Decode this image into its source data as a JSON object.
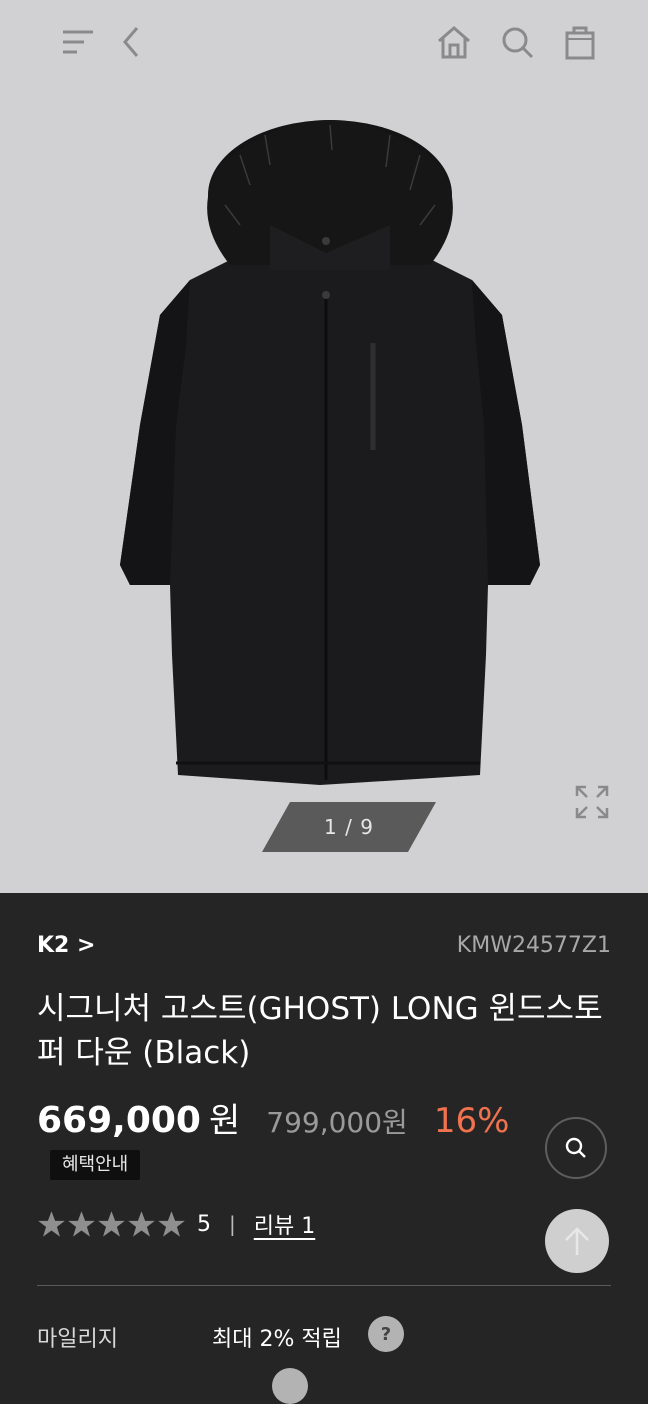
{
  "header": {
    "icons": [
      "menu-icon",
      "back-icon",
      "home-icon",
      "search-icon",
      "shopping-bag-icon"
    ]
  },
  "gallery": {
    "pager": "1 / 9",
    "current": 1,
    "total": 9,
    "image": "black-long-down-parka-with-fur-hood"
  },
  "product": {
    "brand": "K2 >",
    "code": "KMW24577Z1",
    "title": "시그니처 고스트(GHOST) LONG 윈드스토퍼 다운 (Black)",
    "price_sale": "669,000",
    "price_unit": "원",
    "price_original": "799,000원",
    "discount_rate": "16%",
    "benefit_badge": "혜택안내"
  },
  "rating": {
    "stars": 5,
    "score": "5",
    "separator": "|",
    "review_label": "리뷰 1"
  },
  "details": {
    "mileage_label": "마일리지",
    "mileage_value": "최대 2% 적립",
    "help_symbol": "?"
  },
  "colors": {
    "hero_bg": "#d1d1d3",
    "panel_bg": "#252525",
    "discount": "#f0724e",
    "pager_bg": "#5a5a5a"
  }
}
